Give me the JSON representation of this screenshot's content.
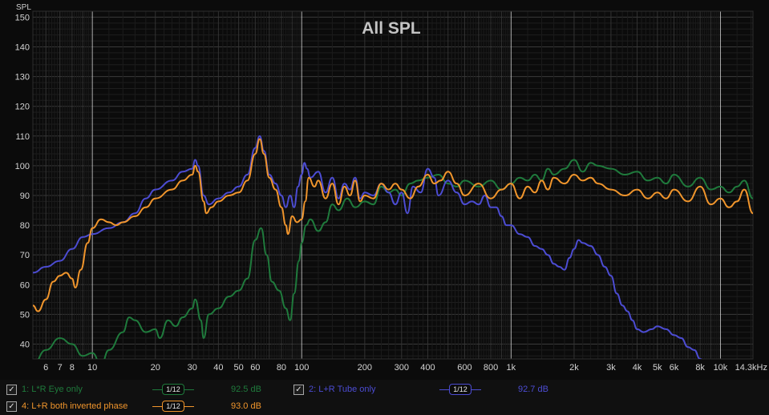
{
  "chart_data": {
    "type": "line",
    "title": "All SPL",
    "ylabel": "SPL",
    "xlabel": "",
    "x_scale": "log",
    "xlim": [
      5.2,
      14300
    ],
    "ylim": [
      35,
      152
    ],
    "y_ticks": [
      40,
      50,
      60,
      70,
      80,
      90,
      100,
      110,
      120,
      130,
      140,
      150
    ],
    "x_ticks": [
      {
        "v": 6,
        "label": "6"
      },
      {
        "v": 7,
        "label": "7"
      },
      {
        "v": 8,
        "label": "8"
      },
      {
        "v": 10,
        "label": "10"
      },
      {
        "v": 20,
        "label": "20"
      },
      {
        "v": 30,
        "label": "30"
      },
      {
        "v": 40,
        "label": "40"
      },
      {
        "v": 50,
        "label": "50"
      },
      {
        "v": 60,
        "label": "60"
      },
      {
        "v": 80,
        "label": "80"
      },
      {
        "v": 100,
        "label": "100"
      },
      {
        "v": 200,
        "label": "200"
      },
      {
        "v": 300,
        "label": "300"
      },
      {
        "v": 400,
        "label": "400"
      },
      {
        "v": 600,
        "label": "600"
      },
      {
        "v": 800,
        "label": "800"
      },
      {
        "v": 1000,
        "label": "1k"
      },
      {
        "v": 2000,
        "label": "2k"
      },
      {
        "v": 3000,
        "label": "3k"
      },
      {
        "v": 4000,
        "label": "4k"
      },
      {
        "v": 5000,
        "label": "5k"
      },
      {
        "v": 6000,
        "label": "6k"
      },
      {
        "v": 8000,
        "label": "8k"
      },
      {
        "v": 10000,
        "label": "10k"
      },
      {
        "v": 14300,
        "label": "14.3kHz"
      }
    ],
    "grid": true,
    "series": [
      {
        "name": "1: L*R Eye only",
        "color": "#1f7a3c",
        "points": [
          [
            5.2,
            33
          ],
          [
            6,
            38
          ],
          [
            7,
            42
          ],
          [
            8,
            40
          ],
          [
            9,
            36
          ],
          [
            10,
            37
          ],
          [
            11,
            33
          ],
          [
            12,
            38
          ],
          [
            14,
            44
          ],
          [
            15,
            49
          ],
          [
            16,
            48
          ],
          [
            18,
            44
          ],
          [
            20,
            45
          ],
          [
            21,
            42
          ],
          [
            23,
            48
          ],
          [
            25,
            46
          ],
          [
            27,
            49
          ],
          [
            30,
            52
          ],
          [
            31,
            55
          ],
          [
            33,
            48
          ],
          [
            34,
            42
          ],
          [
            36,
            50
          ],
          [
            40,
            52
          ],
          [
            45,
            56
          ],
          [
            50,
            58
          ],
          [
            55,
            62
          ],
          [
            60,
            75
          ],
          [
            64,
            79
          ],
          [
            68,
            70
          ],
          [
            72,
            61
          ],
          [
            78,
            58
          ],
          [
            84,
            52
          ],
          [
            88,
            48
          ],
          [
            92,
            57
          ],
          [
            97,
            68
          ],
          [
            100,
            74
          ],
          [
            105,
            80
          ],
          [
            110,
            82
          ],
          [
            120,
            78
          ],
          [
            130,
            81
          ],
          [
            140,
            87
          ],
          [
            150,
            85
          ],
          [
            165,
            89
          ],
          [
            180,
            86
          ],
          [
            200,
            88
          ],
          [
            220,
            87
          ],
          [
            240,
            93
          ],
          [
            260,
            91
          ],
          [
            280,
            92
          ],
          [
            300,
            90
          ],
          [
            330,
            94
          ],
          [
            360,
            95
          ],
          [
            400,
            96
          ],
          [
            450,
            97
          ],
          [
            500,
            94
          ],
          [
            550,
            93
          ],
          [
            600,
            95
          ],
          [
            700,
            93
          ],
          [
            800,
            95
          ],
          [
            900,
            92
          ],
          [
            1000,
            94
          ],
          [
            1100,
            96
          ],
          [
            1200,
            95
          ],
          [
            1300,
            97
          ],
          [
            1400,
            95
          ],
          [
            1500,
            99
          ],
          [
            1600,
            97
          ],
          [
            1800,
            99
          ],
          [
            2000,
            102
          ],
          [
            2200,
            98
          ],
          [
            2400,
            101
          ],
          [
            2600,
            100
          ],
          [
            3000,
            99
          ],
          [
            3500,
            97
          ],
          [
            4000,
            98
          ],
          [
            4500,
            95
          ],
          [
            5000,
            96
          ],
          [
            5500,
            94
          ],
          [
            6000,
            97
          ],
          [
            7000,
            93
          ],
          [
            8000,
            96
          ],
          [
            9000,
            92
          ],
          [
            10000,
            93
          ],
          [
            11000,
            91
          ],
          [
            12000,
            93
          ],
          [
            13000,
            95
          ],
          [
            14300,
            89
          ]
        ]
      },
      {
        "name": "2: L+R Tube only",
        "color": "#4c4cd2",
        "points": [
          [
            5.2,
            64
          ],
          [
            6,
            66
          ],
          [
            7,
            68
          ],
          [
            8,
            72
          ],
          [
            9,
            76
          ],
          [
            10,
            77
          ],
          [
            12,
            79
          ],
          [
            14,
            81
          ],
          [
            16,
            84
          ],
          [
            18,
            89
          ],
          [
            20,
            92
          ],
          [
            24,
            95
          ],
          [
            27,
            98
          ],
          [
            30,
            99
          ],
          [
            31,
            102
          ],
          [
            32,
            100
          ],
          [
            34,
            90
          ],
          [
            36,
            87
          ],
          [
            40,
            89
          ],
          [
            45,
            91
          ],
          [
            50,
            93
          ],
          [
            55,
            97
          ],
          [
            60,
            106
          ],
          [
            63,
            110
          ],
          [
            66,
            105
          ],
          [
            70,
            97
          ],
          [
            75,
            94
          ],
          [
            80,
            90
          ],
          [
            84,
            86
          ],
          [
            88,
            90
          ],
          [
            92,
            86
          ],
          [
            96,
            93
          ],
          [
            100,
            97
          ],
          [
            103,
            101
          ],
          [
            106,
            99
          ],
          [
            110,
            96
          ],
          [
            120,
            98
          ],
          [
            130,
            91
          ],
          [
            140,
            96
          ],
          [
            150,
            89
          ],
          [
            160,
            94
          ],
          [
            170,
            92
          ],
          [
            180,
            96
          ],
          [
            190,
            89
          ],
          [
            200,
            91
          ],
          [
            220,
            90
          ],
          [
            240,
            94
          ],
          [
            260,
            91
          ],
          [
            280,
            87
          ],
          [
            300,
            91
          ],
          [
            320,
            84
          ],
          [
            340,
            93
          ],
          [
            370,
            91
          ],
          [
            400,
            99
          ],
          [
            430,
            96
          ],
          [
            450,
            90
          ],
          [
            500,
            95
          ],
          [
            550,
            91
          ],
          [
            600,
            87
          ],
          [
            650,
            88
          ],
          [
            700,
            87
          ],
          [
            750,
            90
          ],
          [
            800,
            86
          ],
          [
            850,
            86
          ],
          [
            900,
            83
          ],
          [
            950,
            80
          ],
          [
            1000,
            80
          ],
          [
            1100,
            77
          ],
          [
            1200,
            76
          ],
          [
            1300,
            73
          ],
          [
            1400,
            72
          ],
          [
            1500,
            70
          ],
          [
            1600,
            67
          ],
          [
            1700,
            66
          ],
          [
            1800,
            65
          ],
          [
            1900,
            69
          ],
          [
            2000,
            72
          ],
          [
            2100,
            75
          ],
          [
            2200,
            74
          ],
          [
            2400,
            73
          ],
          [
            2600,
            70
          ],
          [
            2800,
            66
          ],
          [
            3000,
            63
          ],
          [
            3200,
            57
          ],
          [
            3400,
            53
          ],
          [
            3600,
            51
          ],
          [
            3800,
            48
          ],
          [
            4000,
            45
          ],
          [
            4300,
            44
          ],
          [
            4700,
            45
          ],
          [
            5000,
            46
          ],
          [
            5500,
            45
          ],
          [
            6000,
            43
          ],
          [
            6500,
            42
          ],
          [
            7000,
            39
          ],
          [
            7500,
            38
          ],
          [
            8000,
            35
          ],
          [
            8500,
            33
          ]
        ]
      },
      {
        "name": "4: L+R both inverted phase",
        "color": "#f0952c",
        "points": [
          [
            5.2,
            53
          ],
          [
            5.5,
            51
          ],
          [
            6,
            55
          ],
          [
            6.5,
            61
          ],
          [
            7,
            63
          ],
          [
            7.5,
            64
          ],
          [
            8,
            62
          ],
          [
            8.3,
            59
          ],
          [
            8.8,
            65
          ],
          [
            9.5,
            74
          ],
          [
            10,
            79
          ],
          [
            11,
            82
          ],
          [
            12,
            81
          ],
          [
            13,
            80
          ],
          [
            14,
            81
          ],
          [
            16,
            83
          ],
          [
            18,
            86
          ],
          [
            20,
            89
          ],
          [
            24,
            92
          ],
          [
            27,
            95
          ],
          [
            30,
            97
          ],
          [
            31,
            100
          ],
          [
            32,
            98
          ],
          [
            34,
            88
          ],
          [
            35,
            84
          ],
          [
            37,
            86
          ],
          [
            40,
            88
          ],
          [
            45,
            90
          ],
          [
            50,
            91
          ],
          [
            55,
            95
          ],
          [
            60,
            104
          ],
          [
            63,
            109
          ],
          [
            66,
            104
          ],
          [
            70,
            96
          ],
          [
            75,
            92
          ],
          [
            80,
            86
          ],
          [
            84,
            80
          ],
          [
            86,
            77
          ],
          [
            90,
            83
          ],
          [
            95,
            81
          ],
          [
            100,
            82
          ],
          [
            104,
            88
          ],
          [
            108,
            96
          ],
          [
            115,
            93
          ],
          [
            120,
            95
          ],
          [
            130,
            89
          ],
          [
            140,
            94
          ],
          [
            150,
            87
          ],
          [
            160,
            93
          ],
          [
            170,
            90
          ],
          [
            180,
            95
          ],
          [
            190,
            88
          ],
          [
            200,
            90
          ],
          [
            220,
            89
          ],
          [
            240,
            94
          ],
          [
            260,
            92
          ],
          [
            280,
            94
          ],
          [
            300,
            92
          ],
          [
            330,
            89
          ],
          [
            360,
            93
          ],
          [
            400,
            97
          ],
          [
            430,
            94
          ],
          [
            460,
            95
          ],
          [
            500,
            98
          ],
          [
            550,
            94
          ],
          [
            600,
            90
          ],
          [
            700,
            94
          ],
          [
            800,
            89
          ],
          [
            900,
            92
          ],
          [
            1000,
            94
          ],
          [
            1100,
            89
          ],
          [
            1200,
            93
          ],
          [
            1300,
            91
          ],
          [
            1400,
            95
          ],
          [
            1500,
            92
          ],
          [
            1600,
            96
          ],
          [
            1800,
            94
          ],
          [
            2000,
            97
          ],
          [
            2200,
            95
          ],
          [
            2400,
            96
          ],
          [
            2600,
            94
          ],
          [
            3000,
            92
          ],
          [
            3500,
            90
          ],
          [
            4000,
            92
          ],
          [
            4500,
            89
          ],
          [
            5000,
            91
          ],
          [
            5500,
            89
          ],
          [
            6000,
            92
          ],
          [
            7000,
            88
          ],
          [
            8000,
            93
          ],
          [
            9000,
            87
          ],
          [
            10000,
            89
          ],
          [
            11000,
            86
          ],
          [
            12000,
            88
          ],
          [
            13000,
            92
          ],
          [
            14300,
            84
          ]
        ]
      }
    ]
  },
  "legend": {
    "items": [
      {
        "label": "1: L*R Eye only",
        "color": "#1f7a3c",
        "smoothing": "1/12",
        "value": "92.5 dB",
        "checked": true
      },
      {
        "label": "2: L+R Tube only",
        "color": "#4c4cd2",
        "smoothing": "1/12",
        "value": "92.7 dB",
        "checked": true
      },
      {
        "label": "4: L+R both inverted phase",
        "color": "#f0952c",
        "smoothing": "1/12",
        "value": "93.0 dB",
        "checked": true
      }
    ]
  }
}
